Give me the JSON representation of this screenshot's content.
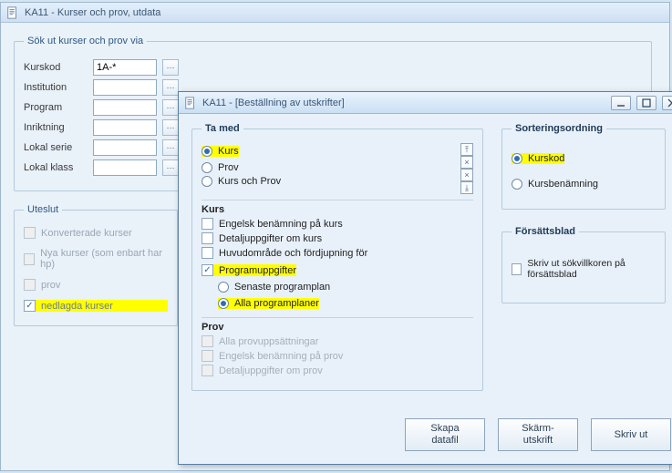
{
  "main": {
    "title": "KA11 - Kurser och prov, utdata",
    "fs_search": "Sök ut kurser och prov via",
    "fields": {
      "kurskod": {
        "label": "Kurskod",
        "value": "1A-*"
      },
      "institution": {
        "label": "Institution",
        "value": ""
      },
      "program": {
        "label": "Program",
        "value": ""
      },
      "inriktning": {
        "label": "Inriktning",
        "value": ""
      },
      "lokalserie": {
        "label": "Lokal serie",
        "value": ""
      },
      "lokalklass": {
        "label": "Lokal klass",
        "value": ""
      }
    },
    "fs_uteslut": "Uteslut",
    "uteslut": {
      "konverterade": {
        "label": "Konverterade kurser",
        "checked": false
      },
      "nyakurser": {
        "label": "Nya kurser (som enbart har hp)",
        "checked": false
      },
      "prov": {
        "label": "prov",
        "checked": false
      },
      "nedlagda": {
        "label": "nedlagda kurser",
        "checked": true
      }
    }
  },
  "dialog": {
    "title": "KA11 - [Beställning av utskrifter]",
    "tamed": {
      "legend": "Ta med",
      "kurs": "Kurs",
      "prov": "Prov",
      "kursochprov": "Kurs och Prov",
      "selected": "kurs"
    },
    "kursgroup": {
      "legend": "Kurs",
      "engelsk": "Engelsk benämning på kurs",
      "detalj": "Detaljuppgifter om kurs",
      "huvud": "Huvudområde och fördjupning för",
      "programuppg": "Programuppgifter",
      "senaste": "Senaste programplan",
      "alla": "Alla programplaner"
    },
    "provgroup": {
      "legend": "Prov",
      "alla": "Alla provuppsättningar",
      "engelsk": "Engelsk benämning på prov",
      "detalj": "Detaljuppgifter om prov"
    },
    "sort": {
      "legend": "Sorteringsordning",
      "kurskod": "Kurskod",
      "kursbenamning": "Kursbenämning"
    },
    "forsatt": {
      "legend": "Försättsblad",
      "label": "Skriv ut sökvillkoren på försättsblad"
    },
    "buttons": {
      "skapa": "Skapa\ndatafil",
      "skarm": "Skärm-\nutskrift",
      "skrivut": "Skriv ut"
    }
  }
}
